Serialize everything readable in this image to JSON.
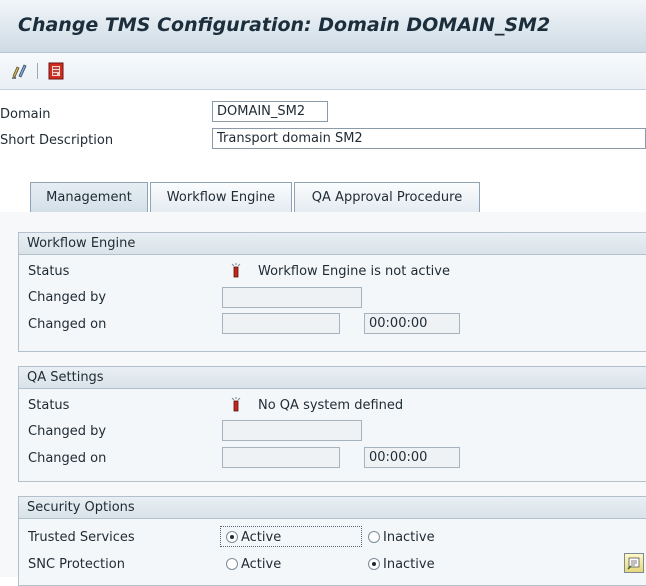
{
  "title": "Change TMS Configuration: Domain DOMAIN_SM2",
  "toolbar": {
    "buttons": [
      {
        "icon": "display-change-icon"
      },
      {
        "icon": "red-document-icon"
      }
    ]
  },
  "header_fields": {
    "domain_label": "Domain",
    "domain_value": "DOMAIN_SM2",
    "short_desc_label": "Short Description",
    "short_desc_value": "Transport domain SM2"
  },
  "tabs": [
    {
      "label": "Management",
      "active": true
    },
    {
      "label": "Workflow Engine",
      "active": false
    },
    {
      "label": "QA Approval Procedure",
      "active": false
    }
  ],
  "workflow_engine": {
    "title": "Workflow Engine",
    "status_label": "Status",
    "status_text": "Workflow Engine is not active",
    "changed_by_label": "Changed by",
    "changed_by_value": "",
    "changed_on_label": "Changed on",
    "changed_on_date": "",
    "changed_on_time": "00:00:00"
  },
  "qa_settings": {
    "title": "QA Settings",
    "status_label": "Status",
    "status_text": "No QA system defined",
    "changed_by_label": "Changed by",
    "changed_by_value": "",
    "changed_on_label": "Changed on",
    "changed_on_date": "",
    "changed_on_time": "00:00:00"
  },
  "security_options": {
    "title": "Security Options",
    "trusted_services_label": "Trusted Services",
    "trusted_services_selected": "Active",
    "snc_protection_label": "SNC Protection",
    "snc_protection_selected": "Inactive",
    "option_active": "Active",
    "option_inactive": "Inactive"
  },
  "colors": {
    "title_bar": "#dde7ee",
    "status_icon_red": "#c0281c"
  }
}
